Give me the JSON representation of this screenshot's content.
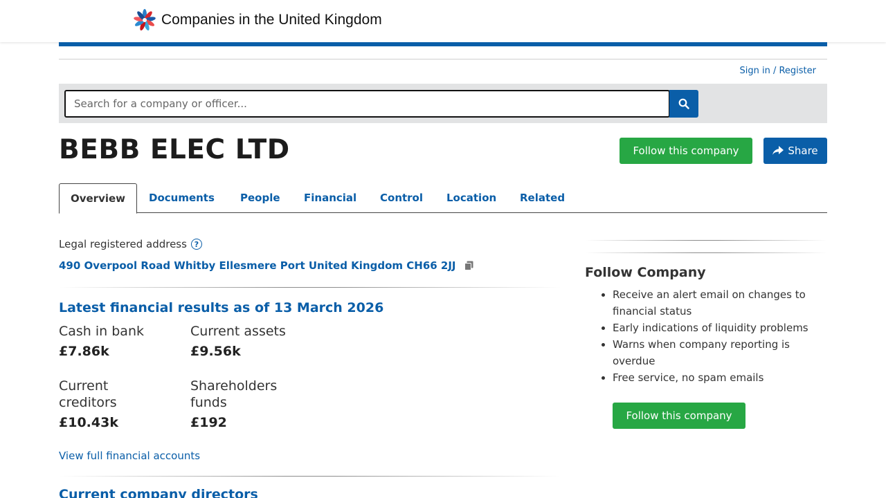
{
  "header": {
    "site_name": "Companies in the United Kingdom",
    "logo_icon": "flower-logo-icon"
  },
  "auth": {
    "sign_in": "Sign in",
    "separator": " / ",
    "register": "Register"
  },
  "search": {
    "placeholder": "Search for a company or officer...",
    "value": "",
    "button_icon": "search-icon"
  },
  "company": {
    "name": "BEBB ELEC LTD",
    "follow_label": "Follow this company",
    "share_label": "Share",
    "share_icon": "share-icon"
  },
  "tabs": [
    {
      "label": "Overview",
      "active": true
    },
    {
      "label": "Documents",
      "active": false
    },
    {
      "label": "People",
      "active": false
    },
    {
      "label": "Financial",
      "active": false
    },
    {
      "label": "Control",
      "active": false
    },
    {
      "label": "Location",
      "active": false
    },
    {
      "label": "Related",
      "active": false
    }
  ],
  "address": {
    "label": "Legal registered address",
    "help_icon": "question-circle-icon",
    "value": "490 Overpool Road Whitby Ellesmere Port United Kingdom CH66 2JJ",
    "copy_icon": "copy-icon"
  },
  "financials": {
    "heading": "Latest financial results as of 13 March 2026",
    "items": [
      {
        "label": "Cash in bank",
        "value": "£7.86k"
      },
      {
        "label": "Current assets",
        "value": "£9.56k"
      },
      {
        "label": "Current creditors",
        "value": "£10.43k"
      },
      {
        "label": "Shareholders funds",
        "value": "£192"
      }
    ],
    "view_link": "View full financial accounts"
  },
  "directors": {
    "heading": "Current company directors"
  },
  "sidebar": {
    "heading": "Follow Company",
    "bullets": [
      "Receive an alert email on changes to financial status",
      "Early indications of liquidity problems",
      "Warns when company reporting is overdue",
      "Free service, no spam emails"
    ],
    "follow_label": "Follow this company"
  },
  "colors": {
    "brand_blue": "#0a5ea8",
    "follow_green": "#27a744",
    "search_band": "#e2e3e4"
  }
}
